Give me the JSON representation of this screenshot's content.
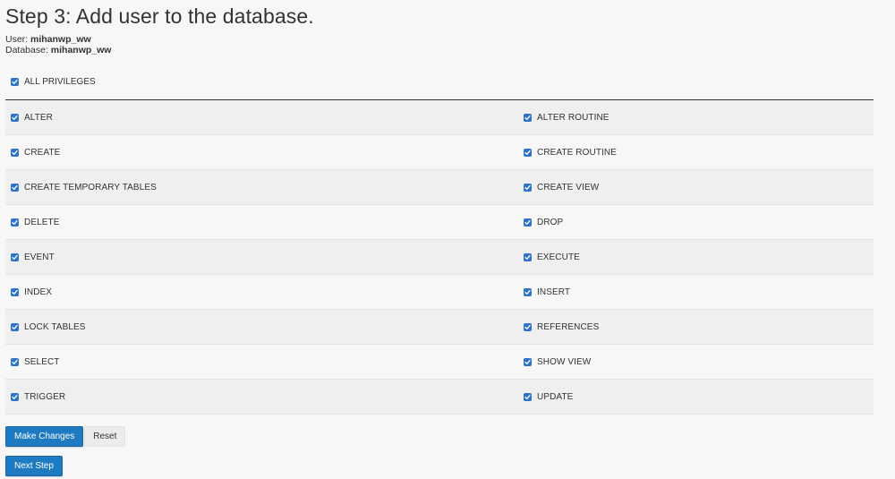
{
  "header": {
    "title": "Step 3: Add user to the database.",
    "user_label": "User:",
    "user_value": "mihanwp_ww",
    "database_label": "Database:",
    "database_value": "mihanwp_ww"
  },
  "all_privileges": {
    "label": "ALL PRIVILEGES",
    "checked": true
  },
  "privileges": [
    {
      "left": "ALTER",
      "right": "ALTER ROUTINE"
    },
    {
      "left": "CREATE",
      "right": "CREATE ROUTINE"
    },
    {
      "left": "CREATE TEMPORARY TABLES",
      "right": "CREATE VIEW"
    },
    {
      "left": "DELETE",
      "right": "DROP"
    },
    {
      "left": "EVENT",
      "right": "EXECUTE"
    },
    {
      "left": "INDEX",
      "right": "INSERT"
    },
    {
      "left": "LOCK TABLES",
      "right": "REFERENCES"
    },
    {
      "left": "SELECT",
      "right": "SHOW VIEW"
    },
    {
      "left": "TRIGGER",
      "right": "UPDATE"
    }
  ],
  "buttons": {
    "make_changes": "Make Changes",
    "reset": "Reset",
    "next_step": "Next Step"
  },
  "colors": {
    "checkbox": "#2f73c9",
    "primary_button": "#1f7bc1",
    "row_shaded": "#efefef",
    "background": "#f7f7f7"
  }
}
